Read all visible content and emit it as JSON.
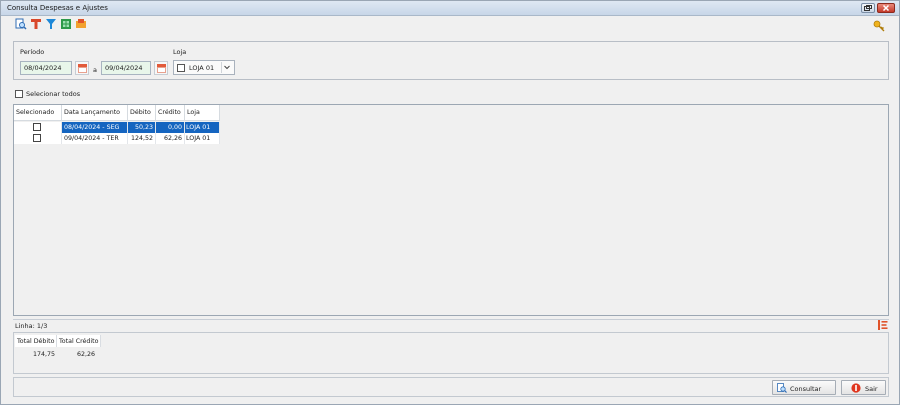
{
  "window": {
    "title": "Consulta Despesas e Ajustes"
  },
  "toolbar": {
    "icons": [
      "search-document-icon",
      "text-tool-icon",
      "filter-icon",
      "spreadsheet-icon",
      "export-icon"
    ],
    "settings_icon": "key-icon"
  },
  "filters": {
    "periodo_label": "Período",
    "date_from": "08/04/2024",
    "separator": "a",
    "date_to": "09/04/2024",
    "loja_label": "Loja",
    "loja_value": "LOJA 01"
  },
  "select_all_label": "Selecionar todos",
  "table": {
    "columns": [
      "Selecionado",
      "Data Lançamento",
      "Débito",
      "Crédito",
      "Loja"
    ],
    "rows": [
      {
        "data": "08/04/2024 - SEG",
        "debito": "50,23",
        "credito": "0,00",
        "loja": "LOJA 01",
        "selected_row": true
      },
      {
        "data": "09/04/2024 - TER",
        "debito": "124,52",
        "credito": "62,26",
        "loja": "LOJA 01",
        "selected_row": false
      }
    ]
  },
  "status": {
    "line": "Linha: 1/3"
  },
  "totals": {
    "debito_label": "Total Débito",
    "credito_label": "Total Crédito",
    "debito_value": "174,75",
    "credito_value": "62,26"
  },
  "buttons": {
    "consultar": "Consultar",
    "sair": "Sair"
  },
  "colors": {
    "selection": "#1565c0",
    "date_bg": "#e8f6ea",
    "exit_icon": "#e0361f"
  }
}
